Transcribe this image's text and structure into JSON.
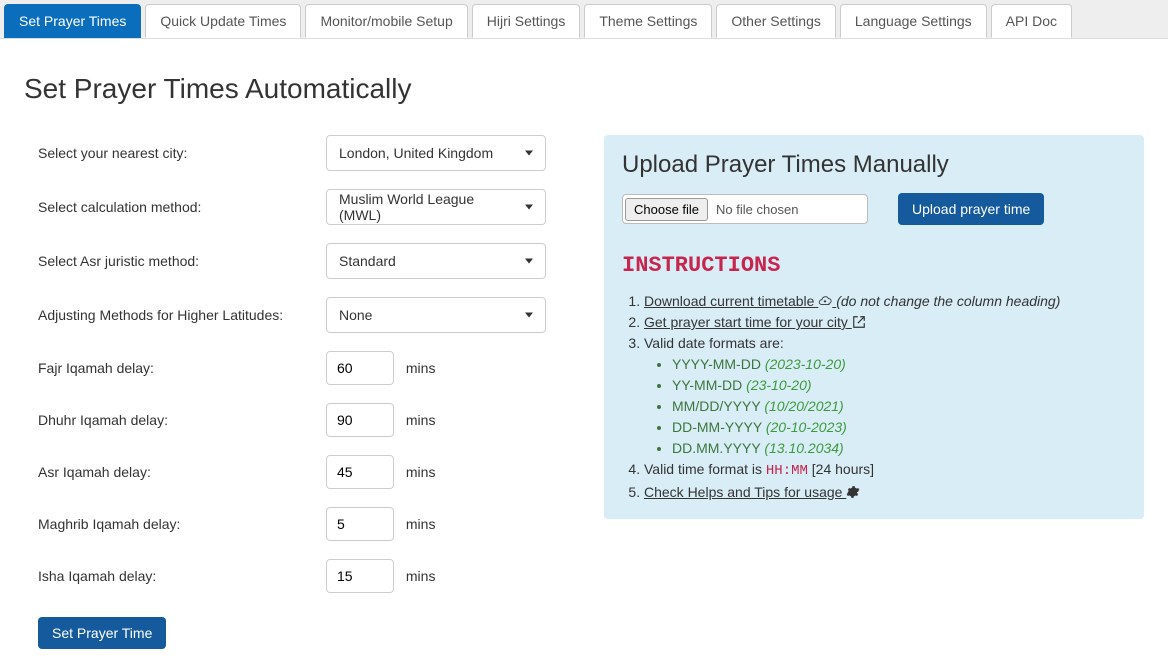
{
  "tabs": [
    {
      "label": "Set Prayer Times"
    },
    {
      "label": "Quick Update Times"
    },
    {
      "label": "Monitor/mobile Setup"
    },
    {
      "label": "Hijri Settings"
    },
    {
      "label": "Theme Settings"
    },
    {
      "label": "Other Settings"
    },
    {
      "label": "Language Settings"
    },
    {
      "label": "API Doc"
    }
  ],
  "page_title": "Set Prayer Times Automatically",
  "form": {
    "city_label": "Select your nearest city:",
    "city_value": "London, United Kingdom",
    "calc_label": "Select calculation method:",
    "calc_value": "Muslim World League (MWL)",
    "asr_label": "Select Asr juristic method:",
    "asr_value": "Standard",
    "highlat_label": "Adjusting Methods for Higher Latitudes:",
    "highlat_value": "None",
    "fajr_label": "Fajr Iqamah delay:",
    "fajr_value": "60",
    "dhuhr_label": "Dhuhr Iqamah delay:",
    "dhuhr_value": "90",
    "asrdelay_label": "Asr Iqamah delay:",
    "asrdelay_value": "45",
    "maghrib_label": "Maghrib Iqamah delay:",
    "maghrib_value": "5",
    "isha_label": "Isha Iqamah delay:",
    "isha_value": "15",
    "mins": "mins",
    "submit": "Set Prayer Time"
  },
  "upload": {
    "heading": "Upload Prayer Times Manually",
    "choose_file": "Choose file",
    "no_file": "No file chosen",
    "upload_btn": "Upload prayer time"
  },
  "instructions": {
    "heading": "INSTRUCTIONS",
    "li1_link": "Download current timetable ",
    "li1_note": " (do not change the column heading)",
    "li2_link": "Get prayer start time for your city ",
    "li3": "Valid date formats are:",
    "formats": [
      {
        "fmt": "YYYY-MM-DD",
        "ex": "(2023-10-20)"
      },
      {
        "fmt": "YY-MM-DD",
        "ex": "(23-10-20)"
      },
      {
        "fmt": "MM/DD/YYYY",
        "ex": "(10/20/2021)"
      },
      {
        "fmt": "DD-MM-YYYY",
        "ex": "(20-10-2023)"
      },
      {
        "fmt": "DD.MM.YYYY",
        "ex": "(13.10.2034)"
      }
    ],
    "li4_pre": "Valid time format is ",
    "li4_code": "HH:MM",
    "li4_suf": " [24 hours]",
    "li5_link": "Check Helps and Tips for usage "
  }
}
